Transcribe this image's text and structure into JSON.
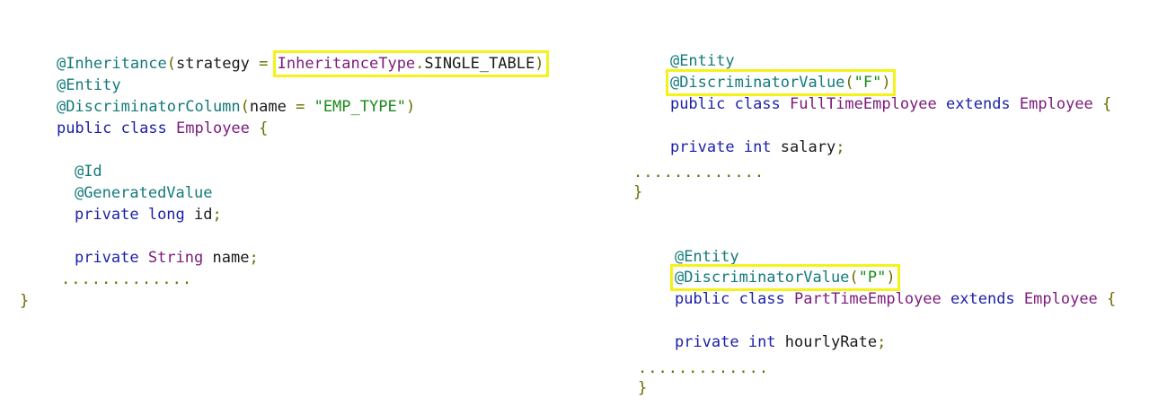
{
  "left": {
    "line1": {
      "ann": "@Inheritance",
      "p1": "(",
      "txt": "strategy",
      "eq": " = ",
      "type": "InheritanceType",
      "dot": ".",
      "const": "SINGLE_TABLE",
      "p2": ")"
    },
    "line2": {
      "ann": "@Entity"
    },
    "line3": {
      "ann": "@DiscriminatorColumn",
      "p1": "(",
      "txt": "name",
      "eq": " = ",
      "str": "\"EMP_TYPE\"",
      "p2": ")"
    },
    "line4": {
      "kw": "public class ",
      "type": "Employee",
      "brace": " {"
    },
    "line5": {
      "ann": "@Id"
    },
    "line6": {
      "ann": "@GeneratedValue"
    },
    "line7": {
      "kw": "private long ",
      "txt": "id",
      "semi": ";"
    },
    "line8": {
      "kw": "private ",
      "type": "String",
      "txt": " name",
      "semi": ";"
    },
    "dots": ".............",
    "close": "}"
  },
  "right_top": {
    "line1": {
      "ann": "@Entity"
    },
    "line2": {
      "ann": "@DiscriminatorValue",
      "p1": "(",
      "str": "\"F\"",
      "p2": ")"
    },
    "line3": {
      "kw": "public class ",
      "type": "FullTimeEmployee",
      "kw2": " extends ",
      "type2": "Employee",
      "brace": " {"
    },
    "line4": {
      "kw": "private int ",
      "txt": "salary",
      "semi": ";"
    },
    "dots": ".............",
    "close": "}"
  },
  "right_bottom": {
    "line1": {
      "ann": "@Entity"
    },
    "line2": {
      "ann": "@DiscriminatorValue",
      "p1": "(",
      "str": "\"P\"",
      "p2": ")"
    },
    "line3": {
      "kw": "public class ",
      "type": "PartTimeEmployee",
      "kw2": " extends ",
      "type2": "Employee",
      "brace": " {"
    },
    "line4": {
      "kw": "private int ",
      "txt": "hourlyRate",
      "semi": ";"
    },
    "dots": ".............",
    "close": "}"
  },
  "colors": {
    "annotation": "#147a7a",
    "keyword": "#1b1fa8",
    "type": "#7b1a7b",
    "string": "#1a8a1a",
    "punctuation": "#6b6b00",
    "highlight": "#f5f21a"
  }
}
